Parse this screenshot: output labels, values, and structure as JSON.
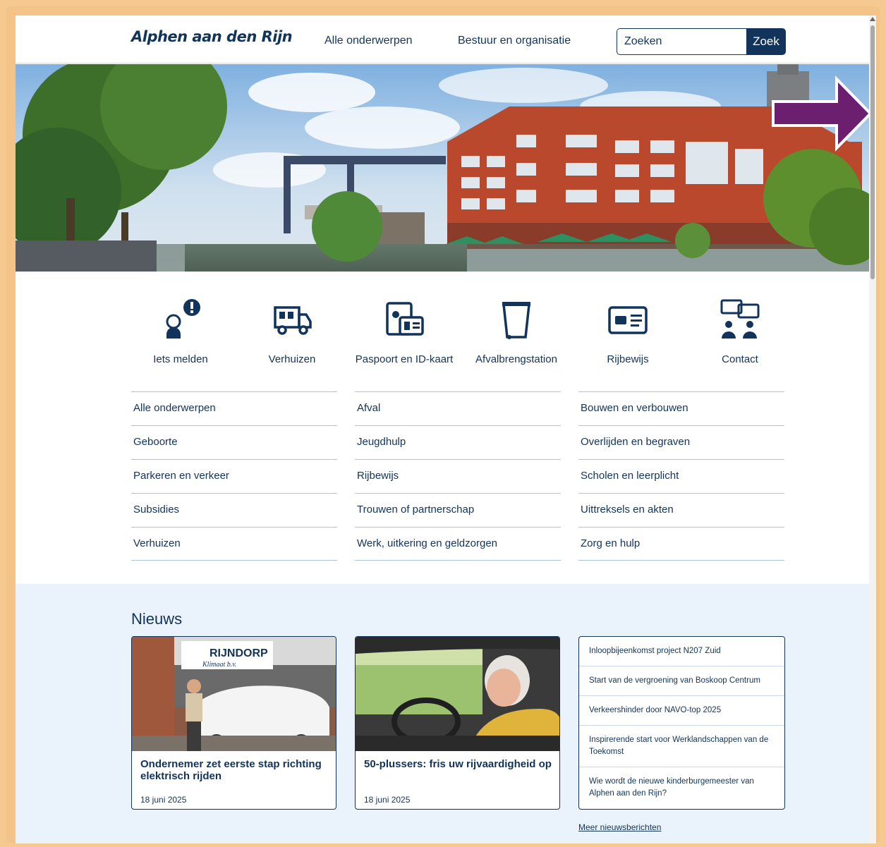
{
  "header": {
    "logo_text": "Alphen aan den Rijn",
    "nav": [
      {
        "label": "Alle onderwerpen"
      },
      {
        "label": "Bestuur en organisatie"
      }
    ],
    "search": {
      "placeholder": "Zoeken",
      "button_label": "Zoek"
    }
  },
  "tasks": [
    {
      "label": "Iets melden",
      "icon": "report-issue-icon"
    },
    {
      "label": "Verhuizen",
      "icon": "moving-truck-icon"
    },
    {
      "label": "Paspoort en ID-kaart",
      "icon": "passport-id-icon"
    },
    {
      "label": "Afvalbrengstation",
      "icon": "waste-bin-icon"
    },
    {
      "label": "Rijbewijs",
      "icon": "drivers-license-icon"
    },
    {
      "label": "Contact",
      "icon": "contact-chat-icon"
    }
  ],
  "topics": {
    "col1": [
      "Alle onderwerpen",
      "Geboorte",
      "Parkeren en verkeer",
      "Subsidies",
      "Verhuizen"
    ],
    "col2": [
      "Afval",
      "Jeugdhulp",
      "Rijbewijs",
      "Trouwen of partnerschap",
      "Werk, uitkering en geldzorgen"
    ],
    "col3": [
      "Bouwen en verbouwen",
      "Overlijden en begraven",
      "Scholen en leerplicht",
      "Uittreksels en akten",
      "Zorg en hulp"
    ]
  },
  "news": {
    "title": "Nieuws",
    "cards": [
      {
        "headline": "Ondernemer zet eerste stap richting elektrisch rijden",
        "date": "18 juni 2025",
        "sign_text": "RIJNDORP",
        "sign_subtext": "Klimaat b.v."
      },
      {
        "headline": "50-plussers: fris uw rijvaardigheid op",
        "date": "18 juni 2025"
      }
    ],
    "list": [
      "Inloopbijeenkomst project N207 Zuid",
      "Start van de vergroening van Boskoop Centrum",
      "Verkeershinder door NAVO-top 2025",
      "Inspirerende start voor Werklandschappen van de Toekomst",
      "Wie wordt de nieuwe kinderburgemeester van Alphen aan den Rijn?"
    ],
    "more_label": "Meer nieuwsberichten"
  },
  "colors": {
    "brand_navy": "#12345a",
    "news_bg": "#eaf3fb",
    "frame": "#f3c48a",
    "annotation_arrow": "#6b1f6e"
  }
}
